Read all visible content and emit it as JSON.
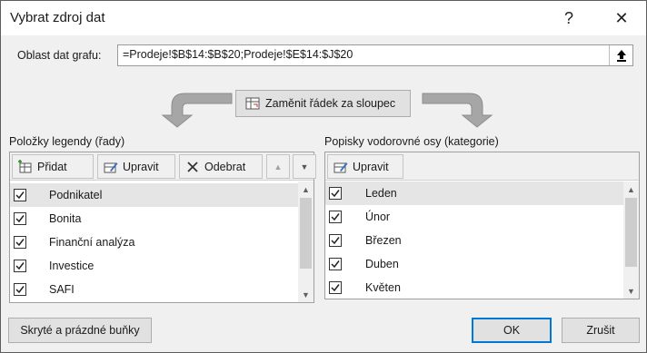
{
  "window": {
    "title": "Vybrat zdroj dat",
    "help_label": "?",
    "close_label": "✕"
  },
  "range": {
    "label": "Oblast dat grafu:",
    "value": "=Prodeje!$B$14:$B$20;Prodeje!$E$14:$J$20"
  },
  "swap_button": {
    "label": "Zaměnit řádek za sloupec"
  },
  "legend": {
    "heading": "Položky legendy (řady)",
    "toolbar": {
      "add": "Přidat",
      "edit": "Upravit",
      "remove": "Odebrat",
      "up": "▲",
      "down": "▼"
    },
    "items": [
      {
        "label": "Podnikatel",
        "checked": true,
        "selected": true
      },
      {
        "label": "Bonita",
        "checked": true,
        "selected": false
      },
      {
        "label": "Finanční analýza",
        "checked": true,
        "selected": false
      },
      {
        "label": "Investice",
        "checked": true,
        "selected": false
      },
      {
        "label": "SAFI",
        "checked": true,
        "selected": false
      }
    ]
  },
  "axis": {
    "heading": "Popisky vodorovné osy (kategorie)",
    "toolbar": {
      "edit": "Upravit"
    },
    "items": [
      {
        "label": "Leden",
        "checked": true,
        "selected": true
      },
      {
        "label": "Únor",
        "checked": true,
        "selected": false
      },
      {
        "label": "Březen",
        "checked": true,
        "selected": false
      },
      {
        "label": "Duben",
        "checked": true,
        "selected": false
      },
      {
        "label": "Květen",
        "checked": true,
        "selected": false
      }
    ]
  },
  "footer": {
    "hidden_cells": "Skryté a prázdné buňky",
    "ok": "OK",
    "cancel": "Zrušit"
  },
  "colors": {
    "accent": "#0078d7",
    "arrow": "#a6a6a6",
    "selection": "#e5e5e5"
  }
}
